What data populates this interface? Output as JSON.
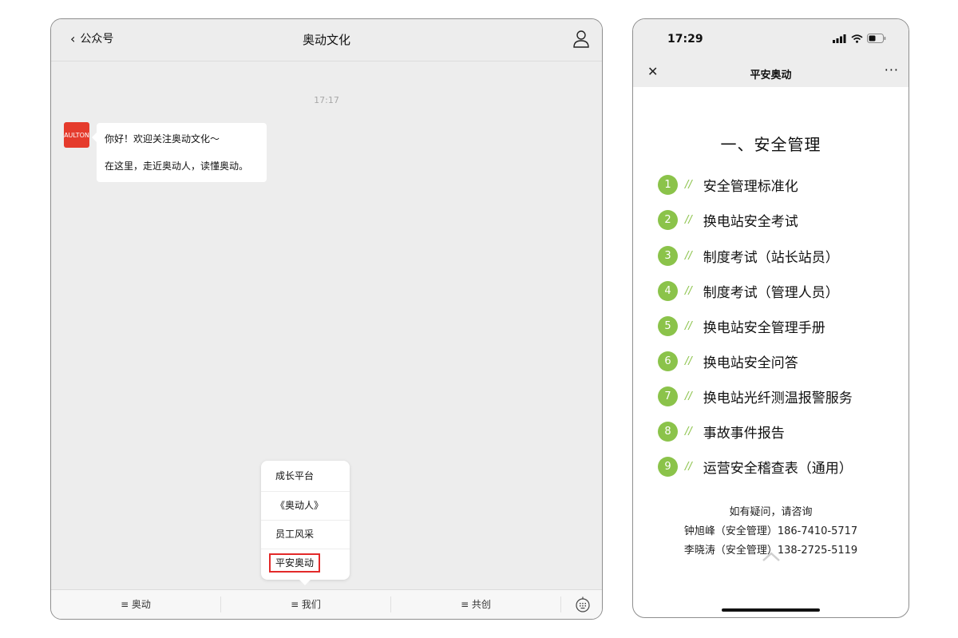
{
  "chat": {
    "back_label": "公众号",
    "title": "奥动文化",
    "timestamp": "17:17",
    "message_line1": "你好！欢迎关注奥动文化～",
    "message_line2": "在这里，走近奥动人，读懂奥动。",
    "popup_items": [
      "成长平台",
      "《奥动人》",
      "员工风采",
      "平安奥动"
    ],
    "tabs": [
      "≡ 奥动",
      "≡ 我们",
      "≡ 共创"
    ]
  },
  "phone": {
    "status_time": "17:29",
    "nav_title": "平安奥动",
    "section_title": "一、安全管理",
    "items": [
      {
        "num": "1",
        "label": "安全管理标准化"
      },
      {
        "num": "2",
        "label": "换电站安全考试"
      },
      {
        "num": "3",
        "label": "制度考试（站长站员）"
      },
      {
        "num": "4",
        "label": "制度考试（管理人员）"
      },
      {
        "num": "5",
        "label": "换电站安全管理手册"
      },
      {
        "num": "6",
        "label": "换电站安全问答"
      },
      {
        "num": "7",
        "label": "换电站光纤测温报警服务"
      },
      {
        "num": "8",
        "label": "事故事件报告"
      },
      {
        "num": "9",
        "label": "运营安全稽查表（通用）"
      }
    ],
    "slashes": "//",
    "contact_heading": "如有疑问，请咨询",
    "contact_1": "钟旭峰（安全管理）186-7410-5717",
    "contact_2": "李晓涛（安全管理）138-2725-5119"
  },
  "colors": {
    "accent_green": "#8bc34a",
    "highlight_red": "#e32a2a",
    "avatar_red": "#e53b2c"
  }
}
